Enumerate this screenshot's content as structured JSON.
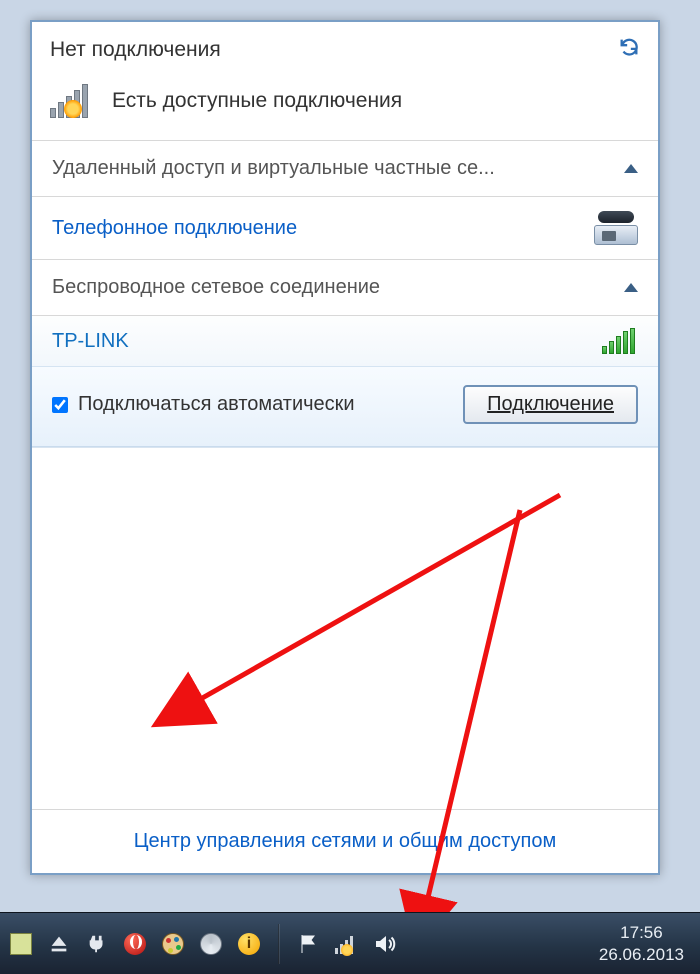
{
  "header": {
    "title": "Нет подключения",
    "status": "Есть доступные подключения"
  },
  "sections": {
    "vpn_label": "Удаленный доступ и виртуальные частные се...",
    "phone_link": "Телефонное подключение",
    "wireless_label": "Беспроводное сетевое соединение"
  },
  "wifi": {
    "name": "TP-LINK",
    "auto_label": "Подключаться автоматически",
    "connect_label": "Подключение",
    "auto_checked": true
  },
  "footer_link": "Центр управления сетями и общим доступом",
  "taskbar": {
    "time": "17:56",
    "date": "26.06.2013"
  }
}
